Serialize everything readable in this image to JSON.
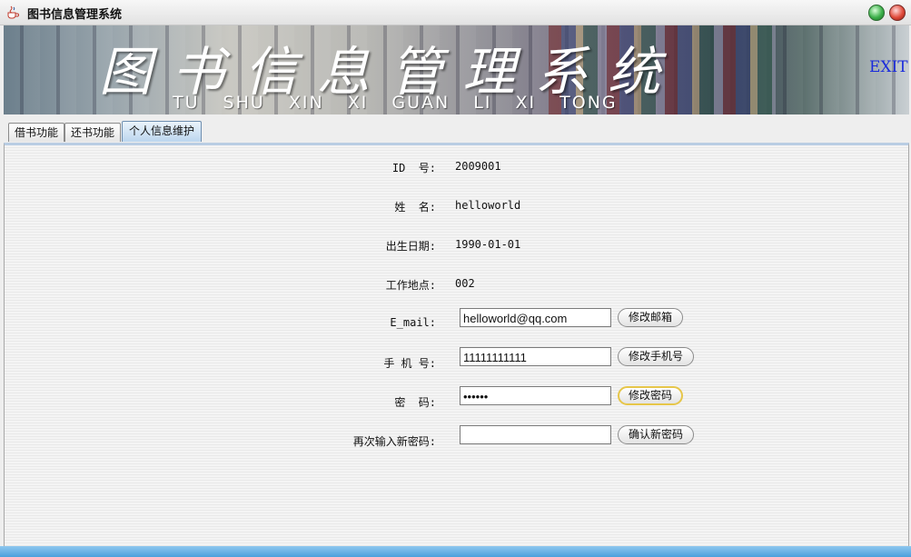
{
  "window": {
    "title": "图书信息管理系统"
  },
  "banner": {
    "title": "图书信息管理系统",
    "pinyin": "TU SHU XIN XI GUAN LI XI TONG",
    "exit": "EXIT"
  },
  "tabs": [
    {
      "label": "借书功能",
      "selected": false
    },
    {
      "label": "还书功能",
      "selected": false
    },
    {
      "label": "个人信息维护",
      "selected": true
    }
  ],
  "form": {
    "id": {
      "label": "ID  号:",
      "value": "2009001"
    },
    "name": {
      "label": "姓  名:",
      "value": "helloworld"
    },
    "birth": {
      "label": "出生日期:",
      "value": "1990-01-01"
    },
    "work": {
      "label": "工作地点:",
      "value": "002"
    },
    "email": {
      "label": "E_mail:",
      "value": "helloworld@qq.com",
      "button": "修改邮箱"
    },
    "phone": {
      "label": "手 机 号:",
      "value": "11111111111",
      "button": "修改手机号"
    },
    "password": {
      "label": "密  码:",
      "value": "••••••",
      "button": "修改密码"
    },
    "confirm": {
      "label": "再次输入新密码:",
      "value": "",
      "button": "确认新密码"
    }
  },
  "colors": {
    "exit": "#1a2bdc",
    "selected_tab": "#bcd6ee",
    "status_bar": "#4aa0dc"
  }
}
